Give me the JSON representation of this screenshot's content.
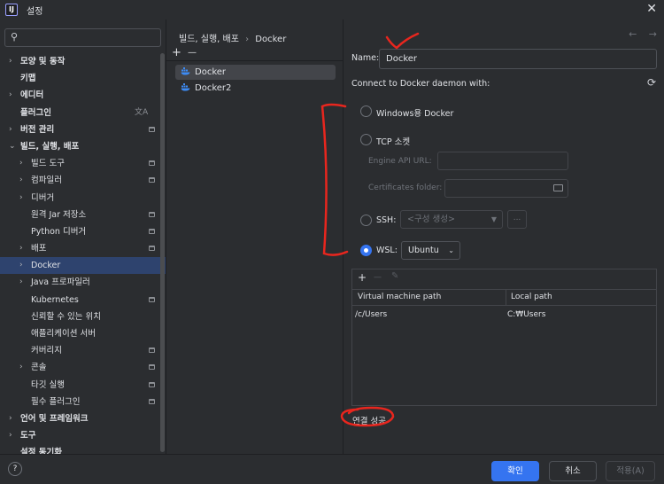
{
  "window": {
    "app_icon_text": "IJ",
    "title": "설정",
    "close_icon": "close-icon"
  },
  "search": {
    "value": "",
    "icon": "search-icon"
  },
  "tree": [
    {
      "label": "모양 및 동작",
      "bold": true,
      "indent": 0,
      "chevron": "›"
    },
    {
      "label": "키맵",
      "bold": true,
      "indent": 0
    },
    {
      "label": "에디터",
      "bold": true,
      "indent": 0,
      "chevron": "›"
    },
    {
      "label": "플러그인",
      "bold": true,
      "indent": 0,
      "translate": "文A"
    },
    {
      "label": "버전 관리",
      "bold": true,
      "indent": 0,
      "chevron": "›",
      "badge": true
    },
    {
      "label": "빌드, 실행, 배포",
      "bold": true,
      "indent": 0,
      "chevron": "⌄"
    },
    {
      "label": "빌드 도구",
      "indent": 1,
      "chevron": "›",
      "badge": true
    },
    {
      "label": "컴파일러",
      "indent": 1,
      "chevron": "›",
      "badge": true
    },
    {
      "label": "디버거",
      "indent": 1,
      "chevron": "›"
    },
    {
      "label": "원격 Jar 저장소",
      "indent": 1,
      "badge": true
    },
    {
      "label": "Python 디버거",
      "indent": 1,
      "badge": true
    },
    {
      "label": "배포",
      "indent": 1,
      "chevron": "›",
      "badge": true
    },
    {
      "label": "Docker",
      "indent": 1,
      "chevron": "›",
      "selected": true
    },
    {
      "label": "Java 프로파일러",
      "indent": 1,
      "chevron": "›"
    },
    {
      "label": "Kubernetes",
      "indent": 1,
      "badge": true
    },
    {
      "label": "신뢰할 수 있는 위치",
      "indent": 1
    },
    {
      "label": "애플리케이션 서버",
      "indent": 1
    },
    {
      "label": "커버리지",
      "indent": 1,
      "badge": true
    },
    {
      "label": "콘솔",
      "indent": 1,
      "chevron": "›",
      "badge": true
    },
    {
      "label": "타깃 실행",
      "indent": 1,
      "badge": true
    },
    {
      "label": "필수 플러그인",
      "indent": 1,
      "badge": true
    },
    {
      "label": "언어 및 프레임워크",
      "bold": true,
      "indent": 0,
      "chevron": "›"
    },
    {
      "label": "도구",
      "bold": true,
      "indent": 0,
      "chevron": "›"
    },
    {
      "label": "설정 동기화",
      "bold": true,
      "indent": 0
    }
  ],
  "breadcrumb": {
    "parent": "빌드, 실행, 배포",
    "separator": "›",
    "current": "Docker"
  },
  "middle": {
    "add_symbol": "+",
    "remove_symbol": "—",
    "items": [
      {
        "label": "Docker",
        "selected": true
      },
      {
        "label": "Docker2",
        "selected": false
      }
    ]
  },
  "nav": {
    "back": "←",
    "forward": "→"
  },
  "form": {
    "name_label": "Name:",
    "name_value": "Docker",
    "connect_label": "Connect to Docker daemon with:",
    "refresh_icon": "refresh-icon",
    "options": {
      "windows": "Windows용 Docker",
      "tcp": "TCP 소켓",
      "engine_api_url": "Engine API URL:",
      "certificates_folder": "Certificates folder:",
      "ssh": "SSH:",
      "ssh_config_placeholder": "<구성 생성>",
      "ssh_more": "...",
      "wsl": "WSL:",
      "wsl_value": "Ubuntu"
    },
    "selected_option": "wsl"
  },
  "paths": {
    "add": "+",
    "remove": "—",
    "edit_icon": "pencil-icon",
    "headers": [
      "Virtual machine path",
      "Local path"
    ],
    "rows": [
      {
        "vm": "/c/Users",
        "local": "C:₩Users"
      }
    ]
  },
  "status_text": "연결 성공",
  "buttons": {
    "help": "?",
    "ok": "확인",
    "cancel": "취소",
    "apply": "적용(A)"
  },
  "annotation_color": "#e8261e",
  "accent": "#3574f0"
}
